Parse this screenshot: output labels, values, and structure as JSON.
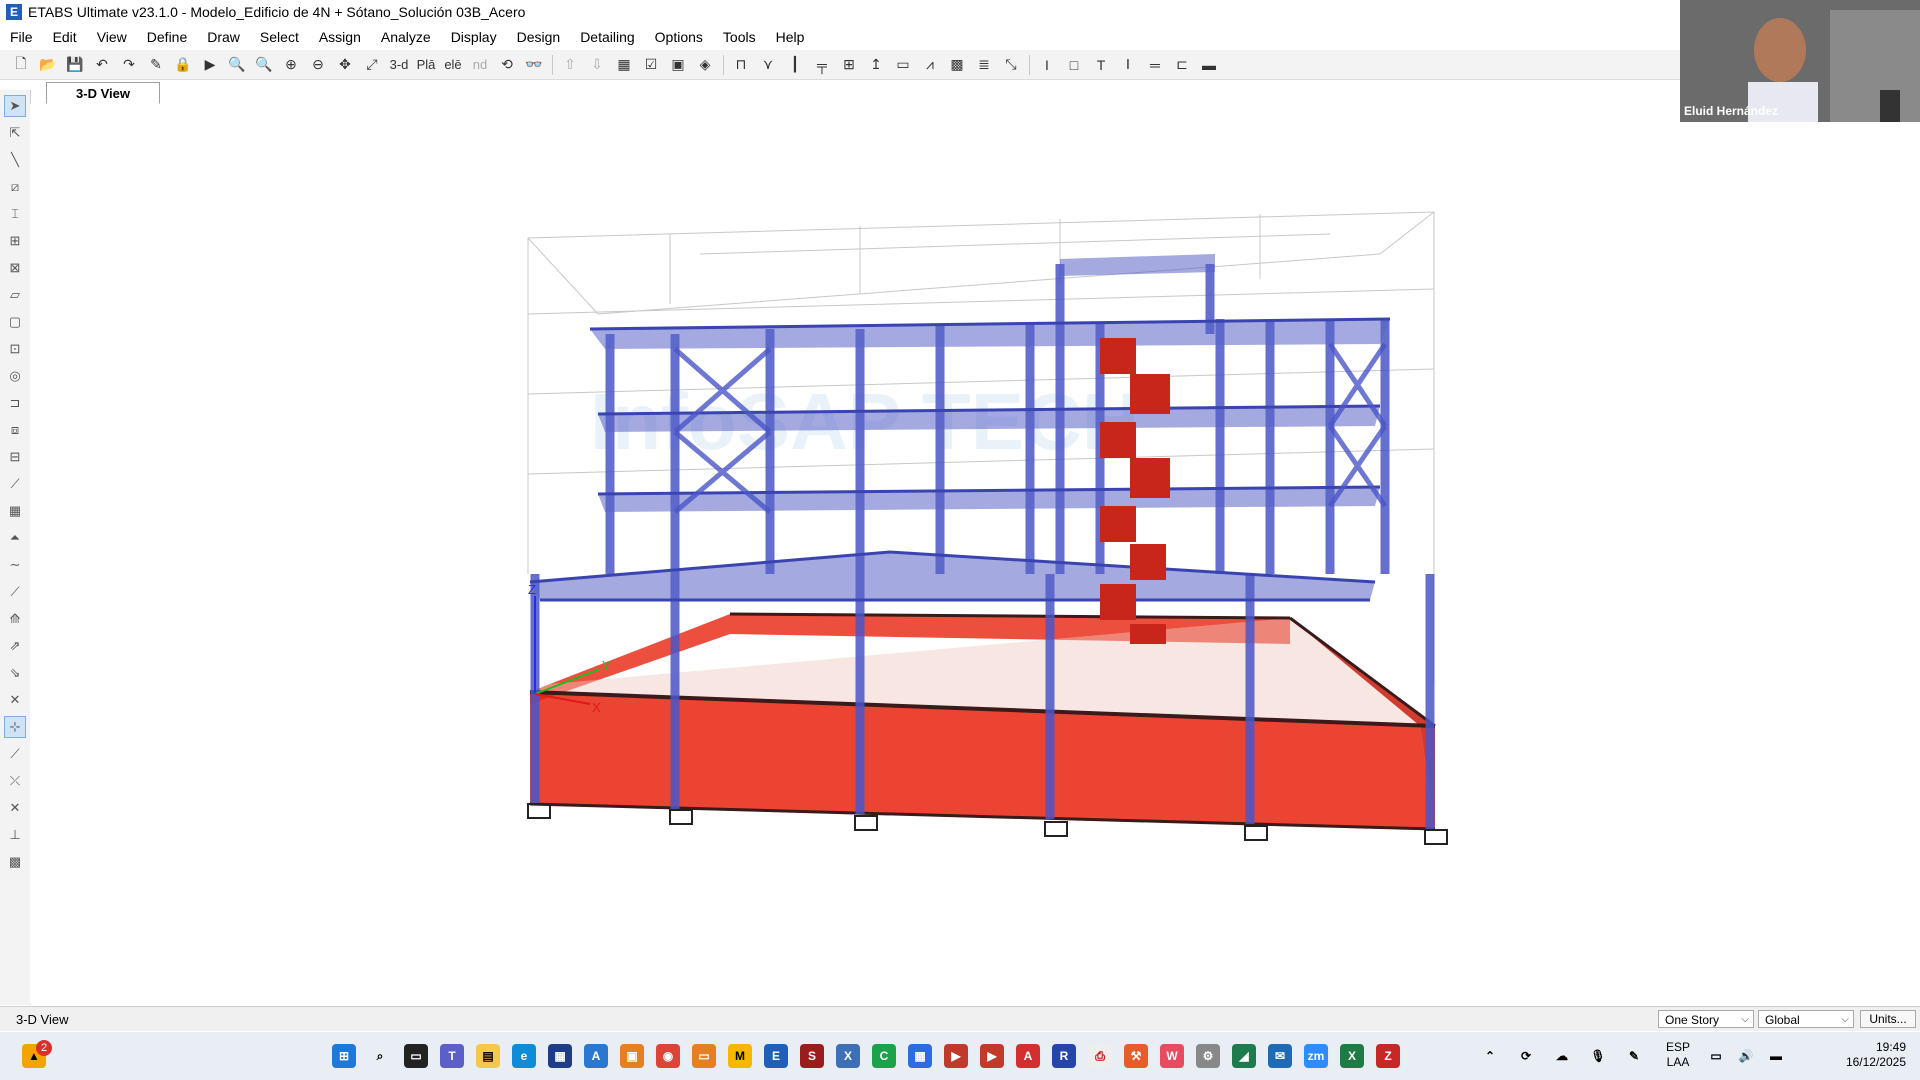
{
  "window": {
    "title": "ETABS Ultimate v23.1.0 - Modelo_Edificio de 4N + Sótano_Solución 03B_Acero",
    "app_icon_letter": "E"
  },
  "menu": [
    "File",
    "Edit",
    "View",
    "Define",
    "Draw",
    "Select",
    "Assign",
    "Analyze",
    "Display",
    "Design",
    "Detailing",
    "Options",
    "Tools",
    "Help"
  ],
  "toolbar": {
    "view_3d_label": "3-d",
    "plan_label": "Plā",
    "elev_label": "elē",
    "nd_label": "nd"
  },
  "tabs": [
    {
      "label": "3-D View",
      "active": true
    }
  ],
  "viewport": {
    "axis_labels": {
      "z": "Z",
      "y": "Y",
      "x": "X"
    },
    "watermark": "InfoSAP TECH"
  },
  "statusbar": {
    "left_text": "3-D View",
    "story_select": "One Story",
    "coord_select": "Global",
    "units_button": "Units..."
  },
  "webcam": {
    "name": "Eluid Hernández"
  },
  "taskbar": {
    "notification_count": "2",
    "language_top": "ESP",
    "language_bottom": "LAA",
    "time": "19:49",
    "date": "16/12/2025"
  },
  "colors": {
    "frame_blue": "#4a56c8",
    "slab_blue": "#5a64c8",
    "wall_red": "#e8230f",
    "stair_red": "#c8261a",
    "grid_gray": "#c8c8c8",
    "accent": "#1f5fb8"
  }
}
